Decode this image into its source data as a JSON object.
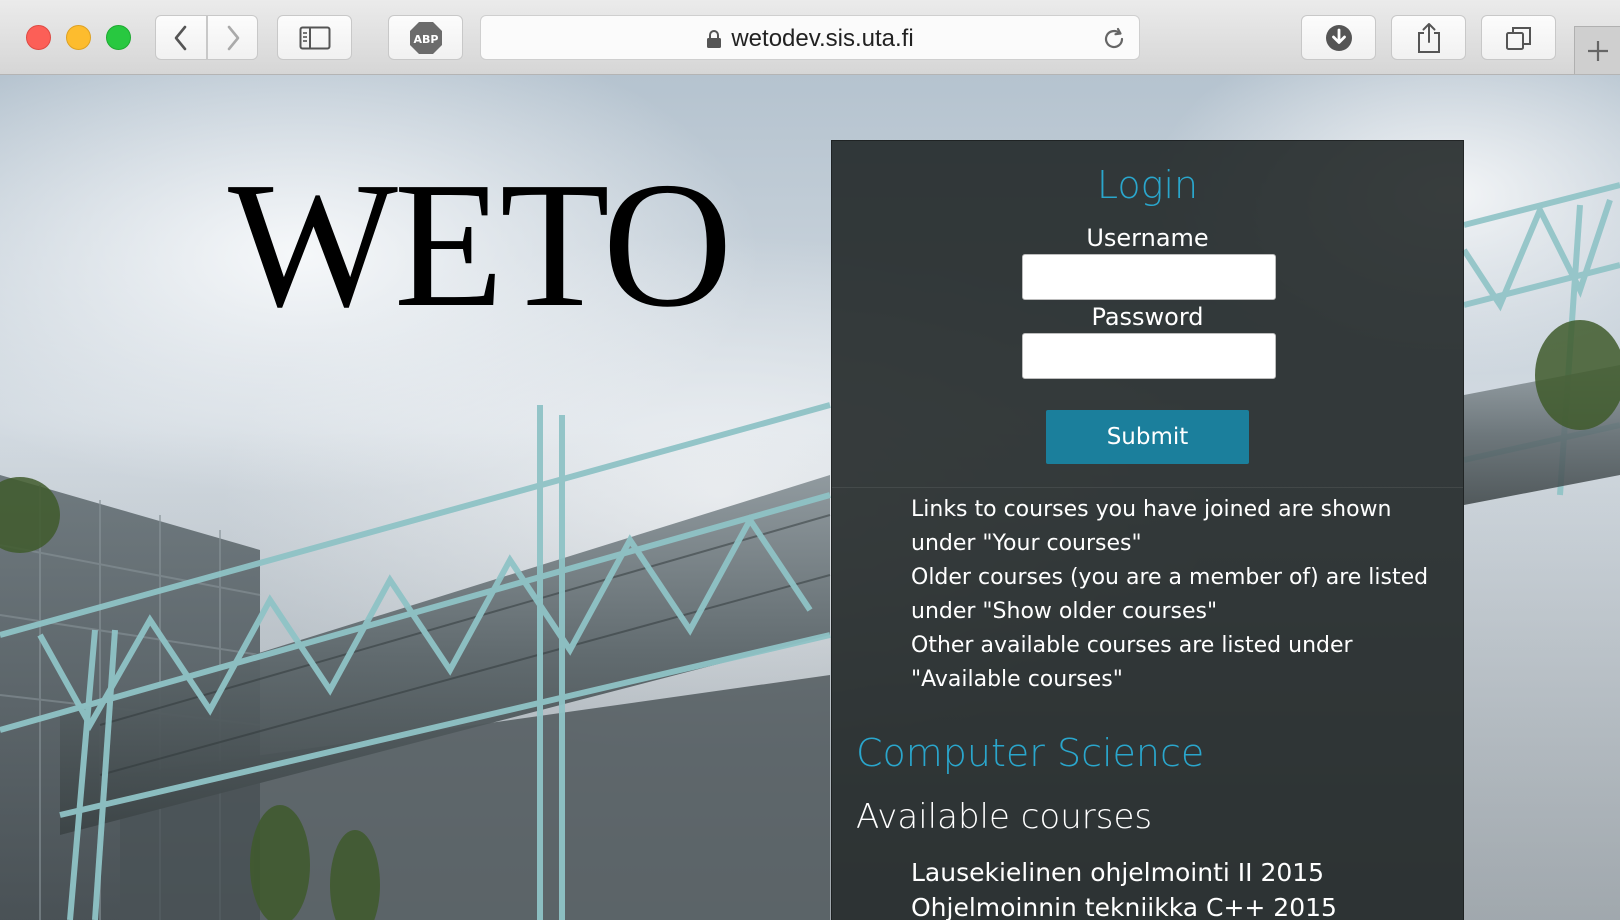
{
  "browser": {
    "url": "wetodev.sis.uta.fi",
    "icons": {
      "back": "chevron-left",
      "forward": "chevron-right",
      "sidebar": "sidebar-toggle",
      "adblock": "ABP",
      "lock": "lock",
      "reload": "reload",
      "download": "download-arrow",
      "share": "share",
      "tabs": "tab-overview",
      "new_tab": "plus"
    }
  },
  "page": {
    "logo": "WETO",
    "login": {
      "title": "Login",
      "username_label": "Username",
      "username_value": "",
      "password_label": "Password",
      "password_value": "",
      "submit_label": "Submit"
    },
    "info": [
      "Links to courses you have joined are shown under \"Your courses\"",
      "Older courses (you are a member of) are listed under \"Show older courses\"",
      "Other available courses are listed under \"Available courses\""
    ],
    "section_title": "Computer Science",
    "subsection_title": "Available courses",
    "courses": [
      "Lausekielinen ohjelmointi II 2015",
      "Ohjelmoinnin tekniikka C++ 2015"
    ]
  },
  "colors": {
    "accent": "#2aa6cc",
    "submit_button": "#1b7f9c",
    "panel": "#1c2121"
  }
}
